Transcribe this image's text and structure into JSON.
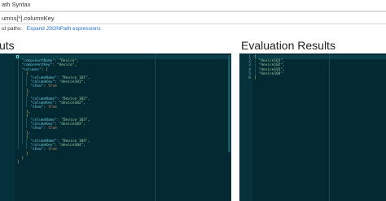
{
  "header": {
    "syntax_label": "ath Syntax"
  },
  "path_input": {
    "value": "umns[*].columnKey"
  },
  "output_paths": {
    "label": "ut paths:",
    "expand_link": "Expand JSONPath expressions"
  },
  "inputs_panel": {
    "heading": "uts"
  },
  "results_panel": {
    "heading": "Evaluation Results"
  },
  "input_editor": {
    "lines": [
      "{",
      "  \"componentName\": \"Device\",",
      "  \"componentKey\": \"device\",",
      "  \"columns\": [",
      "    {",
      "      \"columnName\": \"Device 101\",",
      "      \"columnKey\": \"device101\",",
      "      \"show\": true",
      "    },",
      "    {",
      "      \"columnName\": \"Device 102\",",
      "      \"columnKey\": \"device102\",",
      "      \"show\": true",
      "    },",
      "    {",
      "      \"columnName\": \"Device 103\",",
      "      \"columnKey\": \"device103\",",
      "      \"show\": true",
      "    },",
      "    {",
      "      \"columnName\": \"Device 104\",",
      "      \"columnKey\": \"device104\",",
      "      \"show\": true",
      "    }",
      "  ]",
      "}"
    ]
  },
  "result_editor": {
    "line_numbers": [
      "1",
      "2",
      "3",
      "4",
      "5",
      "6"
    ],
    "lines": [
      "[",
      "  \"device101\",",
      "  \"device102\",",
      "  \"device103\",",
      "  \"device104\"",
      "]"
    ]
  }
}
